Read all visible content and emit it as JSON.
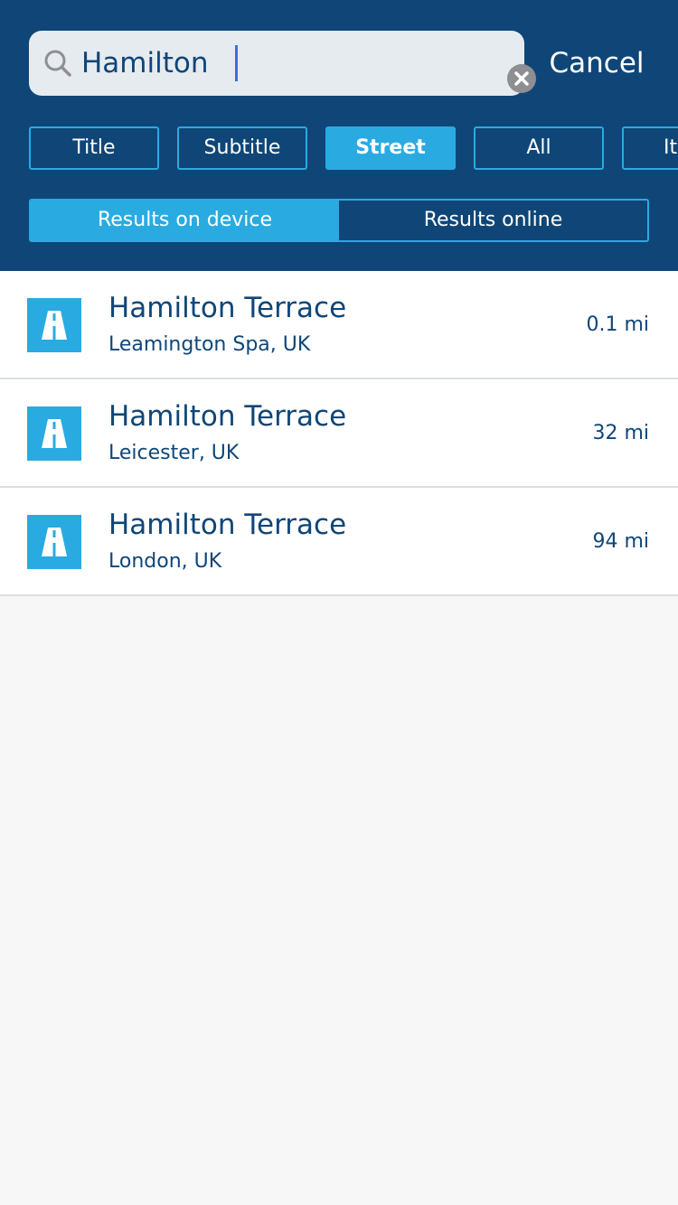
{
  "search": {
    "value": "Hamilton",
    "cancel_label": "Cancel"
  },
  "filters": [
    {
      "label": "Title",
      "active": false
    },
    {
      "label": "Subtitle",
      "active": false
    },
    {
      "label": "Street",
      "active": true
    },
    {
      "label": "All",
      "active": false
    },
    {
      "label": "It",
      "active": false
    }
  ],
  "result_source": {
    "device_label": "Results on device",
    "online_label": "Results online",
    "selected": "device"
  },
  "results": [
    {
      "title": "Hamilton Terrace",
      "subtitle": "Leamington Spa, UK",
      "distance": "0.1 mi",
      "icon": "road-icon"
    },
    {
      "title": "Hamilton Terrace",
      "subtitle": "Leicester, UK",
      "distance": "32 mi",
      "icon": "road-icon"
    },
    {
      "title": "Hamilton Terrace",
      "subtitle": "London, UK",
      "distance": "94 mi",
      "icon": "road-icon"
    }
  ],
  "colors": {
    "header_bg": "#0f4677",
    "accent": "#29abe2",
    "text_dark": "#0f4677",
    "background": "#f7f7f7"
  }
}
